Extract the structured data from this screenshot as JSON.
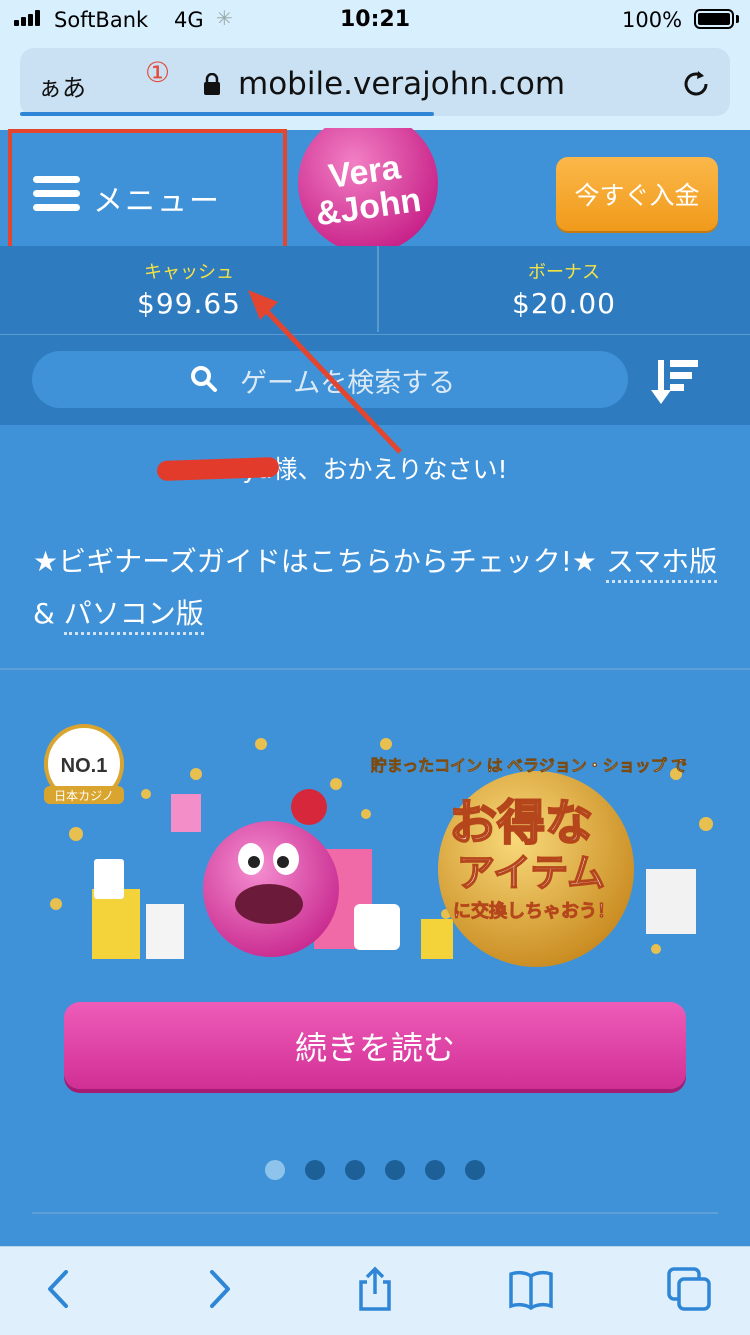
{
  "status_bar": {
    "carrier": "SoftBank",
    "network": "4G",
    "time": "10:21",
    "battery": "100%"
  },
  "browser": {
    "aa_label": "ぁあ",
    "step_marker": "①",
    "url": "mobile.verajohn.com"
  },
  "header": {
    "menu_label": "メニュー",
    "logo_text_1": "Vera",
    "logo_text_2": "&John",
    "deposit_button": "今すぐ入金"
  },
  "balances": {
    "cash_label": "キャッシュ",
    "cash_value": "$99.65",
    "bonus_label": "ボーナス",
    "bonus_value": "$20.00"
  },
  "search": {
    "placeholder": "ゲームを検索する"
  },
  "welcome": {
    "text": "ya様、おかえりなさい!"
  },
  "guide": {
    "text": "★ビギナーズガイドはこちらからチェック!★ ",
    "link_smartphone": "スマホ版",
    "amp": "& ",
    "link_pc": "パソコン版"
  },
  "banner": {
    "badge_no": "NO.1",
    "badge_sub": "日本カジノ",
    "headline_small": "貯まったコイン は ベラジョン・ショップ で",
    "headline_big_1": "お得な",
    "headline_big_2": "アイテム",
    "headline_sub": "に交換しちゃおう！"
  },
  "read_more_button": "続きを読む",
  "carousel": {
    "total": 6,
    "active": 0
  },
  "colors": {
    "page_bg": "#3f92d8",
    "panel_bg": "#2f7bbf",
    "accent_orange": "#f5a623",
    "accent_pink": "#e23fa4",
    "highlight_red": "#e4452f"
  }
}
